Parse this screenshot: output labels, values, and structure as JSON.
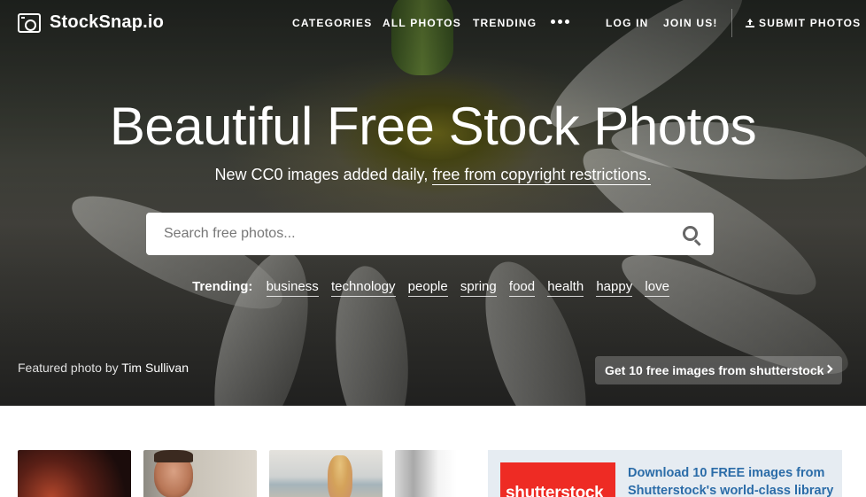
{
  "brand": {
    "name": "StockSnap.io"
  },
  "nav": {
    "categories": "CATEGORIES",
    "all_photos": "ALL PHOTOS",
    "trending": "TRENDING",
    "login": "LOG IN",
    "join": "JOIN US!",
    "submit": "SUBMIT PHOTOS"
  },
  "hero": {
    "title": "Beautiful Free Stock Photos",
    "subtitle_text": "New CC0 images added daily,",
    "subtitle_link": "free from copyright restrictions."
  },
  "search": {
    "placeholder": "Search free photos..."
  },
  "trending": {
    "label": "Trending:",
    "tags": [
      "business",
      "technology",
      "people",
      "spring",
      "food",
      "health",
      "happy",
      "love"
    ]
  },
  "credit": {
    "prefix": "Featured photo by",
    "author": "Tim Sullivan"
  },
  "shutterstock_button": {
    "label": "Get 10 free images from shutterstock"
  },
  "ad": {
    "logo_text": "shutterstock",
    "line1": "Download 10 FREE images from",
    "line2": "Shutterstock's world-class library"
  },
  "colors": {
    "ad_link": "#2b6ca8",
    "shutterstock_red": "#ee2b24",
    "ad_bg": "#e6ecf2"
  }
}
